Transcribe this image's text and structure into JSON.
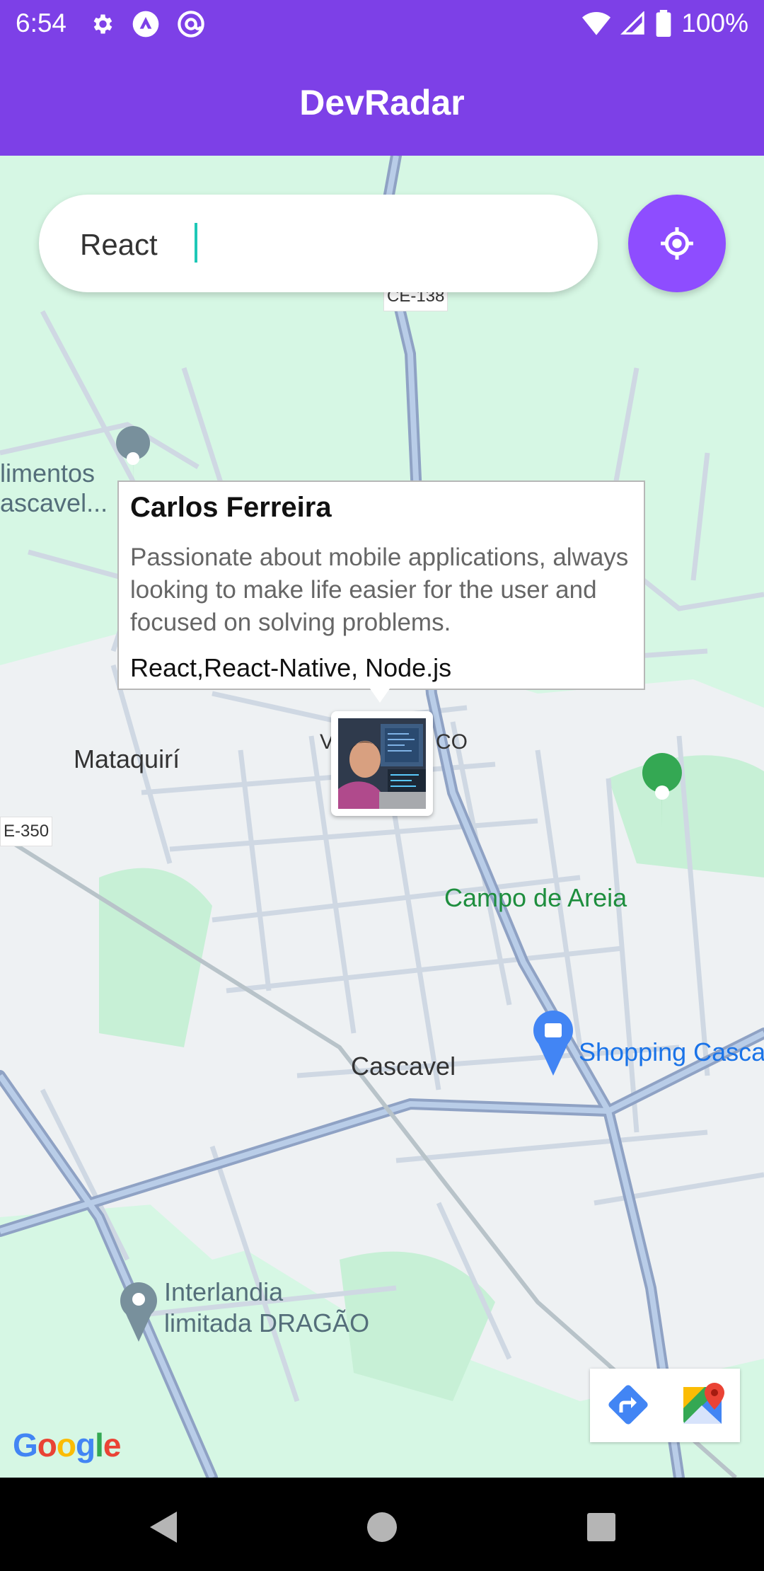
{
  "status_bar": {
    "time": "6:54",
    "battery": "100%"
  },
  "app_bar": {
    "title": "DevRadar"
  },
  "search": {
    "value": "React",
    "placeholder": ""
  },
  "map": {
    "labels": {
      "road_ce138": "CE-138",
      "alimentos_1": "limentos",
      "alimentos_2": "ascavel...",
      "mataquiri": "Mataquirí",
      "vila_left": "V",
      "vila_right": "CO",
      "campo_de_areia": "Campo de Areia",
      "shopping": "Shopping Casca",
      "cascavel": "Cascavel",
      "road_ce350": "E-350",
      "interlandia_1": "Interlandia",
      "interlandia_2": "limitada DRAGÃO"
    },
    "google_logo": "Google"
  },
  "callout": {
    "name": "Carlos Ferreira",
    "bio": "Passionate about mobile applications, always looking to make life easier for the user and focused on solving problems.",
    "techs": "React,React-Native, Node.js"
  },
  "colors": {
    "primary": "#7d40e7",
    "locate_button": "#8e4dff",
    "map_bg": "#d6f7e4"
  }
}
